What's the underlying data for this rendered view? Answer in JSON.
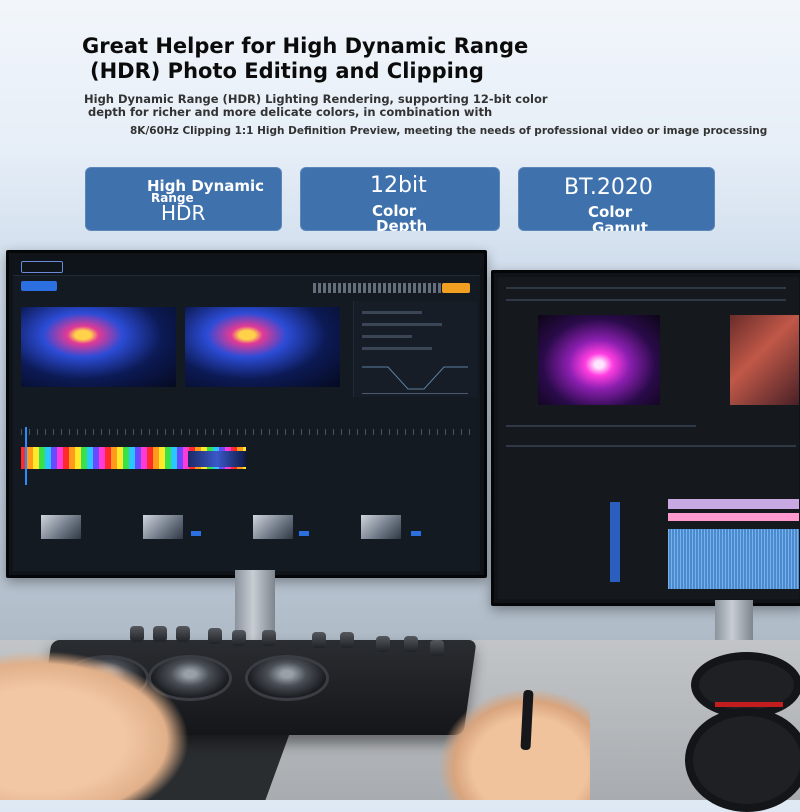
{
  "headline": {
    "line1": "Great Helper for High Dynamic Range",
    "line2": "(HDR) Photo Editing and Clipping"
  },
  "description": {
    "line1": "High Dynamic Range (HDR) Lighting Rendering, supporting 12-bit color",
    "line2": "depth for richer and more delicate colors, in combination with",
    "line3": "8K/60Hz Clipping 1:1 High Definition Preview, meeting the needs of professional video or image processing"
  },
  "badges": [
    {
      "top_text": "High Dynamic",
      "mid_text": "Range",
      "big_text": "HDR"
    },
    {
      "big_text": "12bit",
      "bold1": "Color",
      "bold2": "Depth"
    },
    {
      "big_text": "BT.2020",
      "bold1": "Color",
      "bold2": "Gamut"
    }
  ],
  "colors": {
    "badge_blue": "#3f72ad",
    "accent_orange": "#f0a020",
    "accent_blue": "#2b6fe0"
  },
  "icons": [
    "monitor-icon",
    "color-console-icon",
    "camera-lens-icon"
  ]
}
